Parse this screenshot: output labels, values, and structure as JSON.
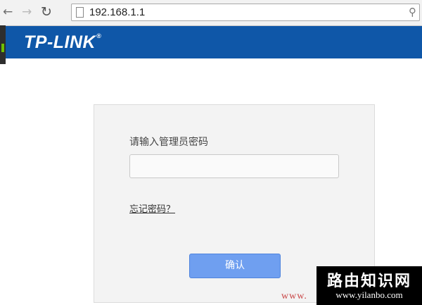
{
  "browser": {
    "url": "192.168.1.1",
    "back_icon": "back-arrow-icon",
    "forward_icon": "forward-arrow-icon",
    "reload_icon": "reload-icon",
    "search_icon": "search-icon"
  },
  "header": {
    "logo": "TP-LINK",
    "logo_mark": "®",
    "bg_color": "#0f57a8"
  },
  "login": {
    "prompt": "请输入管理员密码",
    "password_value": "",
    "forgot_link": "忘记密码？",
    "confirm_button": "确认",
    "button_color": "#6f9ff0"
  },
  "watermark": {
    "site_prefix": "www.",
    "title": "路由知识网",
    "url": "www.yilanbo.com"
  }
}
